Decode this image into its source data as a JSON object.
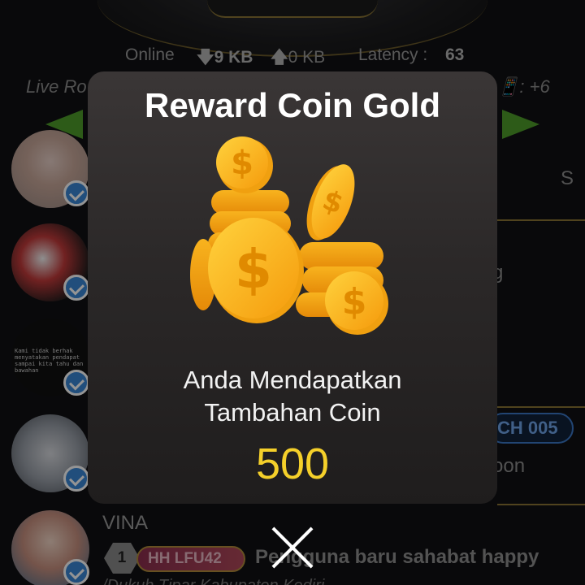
{
  "status_bar": {
    "online_label": "Online",
    "download": "9 KB",
    "upload": "0 KB",
    "latency_label": "Latency :",
    "latency_value": "63"
  },
  "background": {
    "live_label": "Live Ro",
    "right_label": "📱: +6",
    "right_texts": [
      "S",
      "g",
      "CH 005",
      "oon"
    ],
    "user": {
      "name": "VINA",
      "level": "1",
      "tag": "HH LFU42",
      "message": "Pengguna baru sahabat happy",
      "second_line": "/Dukuh Tipar Kabupaten Kediri"
    },
    "avatar_quote": "Kami tidak berhak menyatakan pendapat sampai kita tahu dan bawahan"
  },
  "modal": {
    "title": "Reward Coin Gold",
    "message_line1": "Anda Mendapatkan",
    "message_line2": "Tambahan Coin",
    "amount": "500",
    "close_icon": "close-icon"
  },
  "colors": {
    "amount": "#f5d02a",
    "coin": "#f5b21a",
    "verified": "#3a87d6",
    "ch_badge": "#3b78c6",
    "tag_badge": "#b0485a",
    "arrow": "#4f9d2a"
  }
}
